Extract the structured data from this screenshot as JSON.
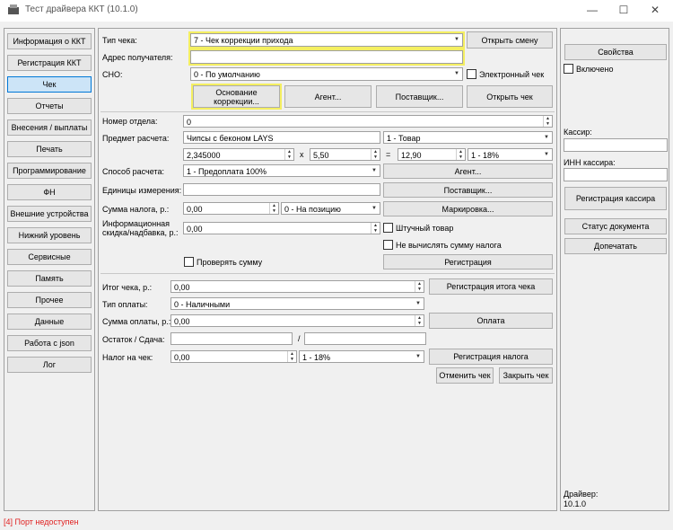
{
  "window": {
    "title": "Тест драйвера ККТ (10.1.0)",
    "minimize_glyph": "—",
    "maximize_glyph": "☐",
    "close_glyph": "✕"
  },
  "nav": {
    "info": "Информация о ККТ",
    "registration": "Регистрация ККТ",
    "receipt": "Чек",
    "reports": "Отчеты",
    "deposits": "Внесения / выплаты",
    "print": "Печать",
    "programming": "Программирование",
    "fn": "ФН",
    "ext_devices": "Внешние устройства",
    "low_level": "Нижний уровень",
    "service": "Сервисные",
    "memory": "Память",
    "other": "Прочее",
    "data": "Данные",
    "json": "Работа с json",
    "log": "Лог"
  },
  "receipt": {
    "type_label": "Тип чека:",
    "type_value": "7 - Чек коррекции прихода",
    "open_shift": "Открыть смену",
    "recipient_label": "Адрес получателя:",
    "recipient_value": "",
    "sno_label": "СНО:",
    "sno_value": "0 - По умолчанию",
    "electronic_label": "Электронный чек",
    "correction_basis": "Основание коррекции...",
    "agent": "Агент...",
    "supplier": "Поставщик...",
    "open_receipt": "Открыть чек"
  },
  "position": {
    "dept_label": "Номер отдела:",
    "dept_value": "0",
    "item_label": "Предмет расчета:",
    "item_value": "Чипсы с беконом LAYS",
    "item_type": "1 - Товар",
    "qty": "2,345000",
    "x_sign": "x",
    "price": "5,50",
    "eq_sign": "=",
    "total": "12,90",
    "vat": "1 - 18%",
    "method_label": "Способ расчета:",
    "method_value": "1 - Предоплата 100%",
    "agent": "Агент...",
    "units_label": "Единицы измерения:",
    "units_value": "",
    "supplier": "Поставщик...",
    "tax_sum_label": "Сумма налога, р.:",
    "tax_sum_value": "0,00",
    "tax_mode": "0 - На позицию",
    "marking": "Маркировка...",
    "discount_label": "Информационная скидка/надбавка, р.:",
    "discount_value": "0,00",
    "piece_label": "Штучный товар",
    "no_tax_calc_label": "Не вычислять сумму налога",
    "check_sum_label": "Проверять сумму",
    "register": "Регистрация"
  },
  "totals": {
    "total_label": "Итог чека, р.:",
    "total_value": "0,00",
    "register_total": "Регистрация итога чека",
    "pay_type_label": "Тип оплаты:",
    "pay_type_value": "0 - Наличными",
    "pay_sum_label": "Сумма оплаты, р.:",
    "pay_sum_value": "0,00",
    "pay": "Оплата",
    "remainder_label": "Остаток / Сдача:",
    "remainder_value": "",
    "slash": "/",
    "change_value": "",
    "tax_label": "Налог на чек:",
    "tax_value": "0,00",
    "tax_rate": "1 - 18%",
    "register_tax": "Регистрация налога",
    "cancel": "Отменить чек",
    "close": "Закрыть чек"
  },
  "right": {
    "properties": "Свойства",
    "enabled_label": "Включено",
    "cashier_label": "Кассир:",
    "cashier_value": "",
    "inn_label": "ИНН кассира:",
    "inn_value": "",
    "register_cashier": "Регистрация кассира",
    "doc_status": "Статус документа",
    "reprint": "Допечатать",
    "driver_label": "Драйвер:",
    "driver_version": "10.1.0"
  },
  "status": {
    "text": "[4] Порт недоступен",
    "color": "#e02020"
  },
  "highlight_color": "#f4ef61",
  "active_color": "#cce4f7"
}
